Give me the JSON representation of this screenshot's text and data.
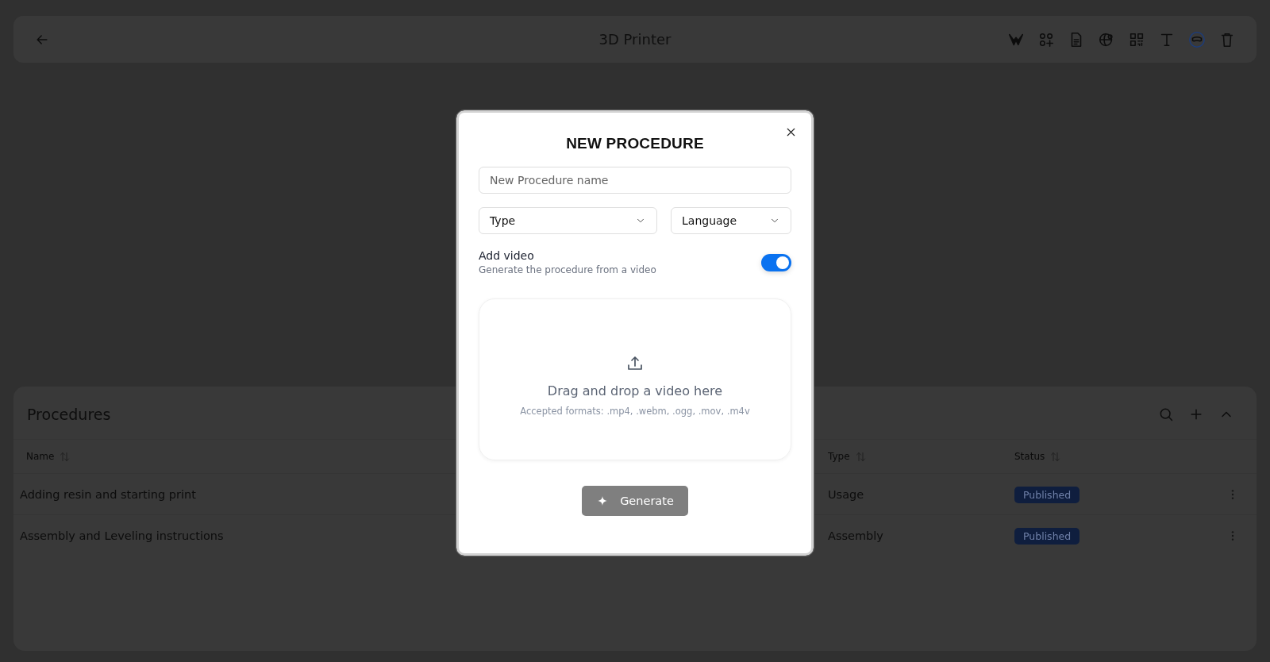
{
  "header": {
    "title": "3D Printer",
    "toolbar": [
      {
        "kind": "logo"
      },
      {
        "kind": "shapes"
      },
      {
        "kind": "document"
      },
      {
        "kind": "globe"
      },
      {
        "kind": "qr"
      },
      {
        "kind": "text"
      },
      {
        "kind": "visor",
        "selected": true
      },
      {
        "kind": "trash"
      }
    ]
  },
  "procedures": {
    "title": "Procedures",
    "columns": [
      {
        "label": "Name"
      },
      {
        "label": "Type"
      },
      {
        "label": "Status"
      }
    ],
    "rows": [
      {
        "name": "Adding resin and starting print",
        "type": "Usage",
        "status": "Published"
      },
      {
        "name": "Assembly and Leveling instructions",
        "type": "Assembly",
        "status": "Published"
      }
    ]
  },
  "dialog": {
    "title": "NEW PROCEDURE",
    "name_field": {
      "placeholder": "New Procedure name"
    },
    "type_select": {
      "placeholder": "Type"
    },
    "language_select": {
      "placeholder": "Language"
    },
    "add_video": {
      "label": "Add video",
      "description": "Generate the procedure from a video",
      "on": true
    },
    "dropzone": {
      "text": "Drag and drop a video here",
      "formats": "Accepted formats: .mp4, .webm, .ogg, .mov, .m4v"
    },
    "generate_button": {
      "label": "Generate",
      "disabled": true
    }
  }
}
